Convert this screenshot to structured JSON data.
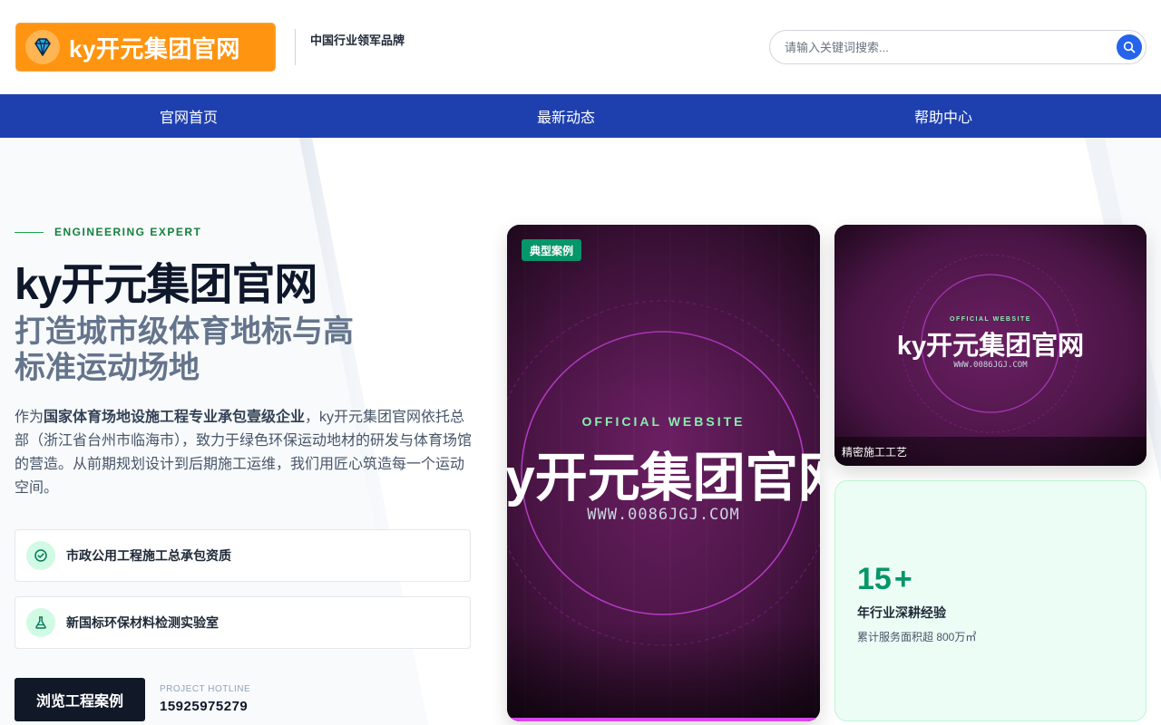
{
  "header": {
    "logo_text": "ky开元集团官网",
    "slogan": "中国行业领军品牌",
    "search_placeholder": "请输入关键词搜索..."
  },
  "nav": {
    "items": [
      {
        "label": "官网首页"
      },
      {
        "label": "最新动态"
      },
      {
        "label": "帮助中心"
      }
    ]
  },
  "hero": {
    "eyebrow": "ENGINEERING EXPERT",
    "title": "ky开元集团官网",
    "subtitle": "打造城市级体育地标与高标准运动场地",
    "description_prefix": "作为",
    "description_bold": "国家体育场地设施工程专业承包壹级企业",
    "description_suffix": "，ky开元集团官网依托总部（浙江省台州市临海市），致力于绿色环保运动地材的研发与体育场馆的营造。从前期规划设计到后期施工运维，我们用匠心筑造每一个运动空间。",
    "features": [
      {
        "icon": "check-circle-icon",
        "label": "市政公用工程施工总承包资质"
      },
      {
        "icon": "flask-icon",
        "label": "新国标环保材料检测实验室"
      }
    ],
    "cta_label": "浏览工程案例",
    "hotline_label": "PROJECT HOTLINE",
    "hotline_number": "15925975279"
  },
  "cards": {
    "main": {
      "badge": "典型案例",
      "tagline": "OFFICIAL WEBSITE",
      "title": "ky开元集团官网",
      "url": "WWW.0086JGJ.COM"
    },
    "top": {
      "tagline": "OFFICIAL WEBSITE",
      "title": "ky开元集团官网",
      "url": "WWW.0086JGJ.COM",
      "caption": "精密施工工艺"
    },
    "stats": {
      "number": "15",
      "suffix": "+",
      "label": "年行业深耕经验",
      "sub": "累计服务面积超 800万㎡"
    }
  },
  "colors": {
    "brand_orange": "#ff9410",
    "nav_blue": "#1e40af",
    "accent_green": "#059669",
    "card_dark": "#3b1237",
    "magenta": "#d946ef"
  }
}
